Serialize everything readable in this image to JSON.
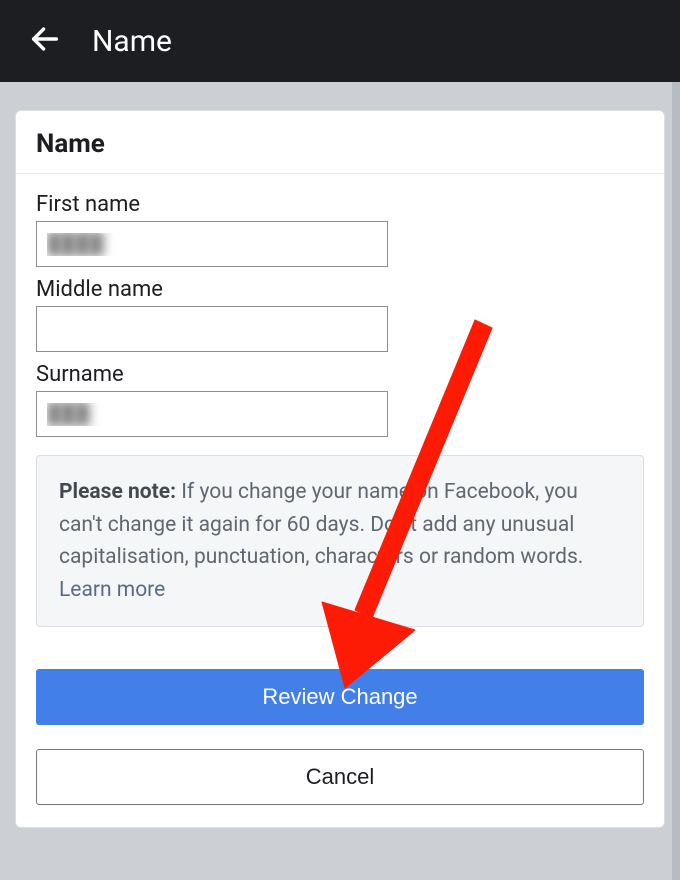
{
  "header": {
    "title": "Name"
  },
  "card": {
    "title": "Name"
  },
  "form": {
    "first_name_label": "First name",
    "first_name_value": "████",
    "middle_name_label": "Middle name",
    "middle_name_value": "",
    "surname_label": "Surname",
    "surname_value": "███"
  },
  "notice": {
    "bold": "Please note:",
    "text": " If you change your name on Facebook, you can't change it again for 60 days. Don't add any unusual capitalisation, punctuation, characters or random words. ",
    "learn_more": "Learn more"
  },
  "actions": {
    "primary": "Review Change",
    "secondary": "Cancel"
  },
  "colors": {
    "primary": "#427FE8",
    "header_bg": "#1c1e21",
    "arrow": "#FE1B05"
  }
}
